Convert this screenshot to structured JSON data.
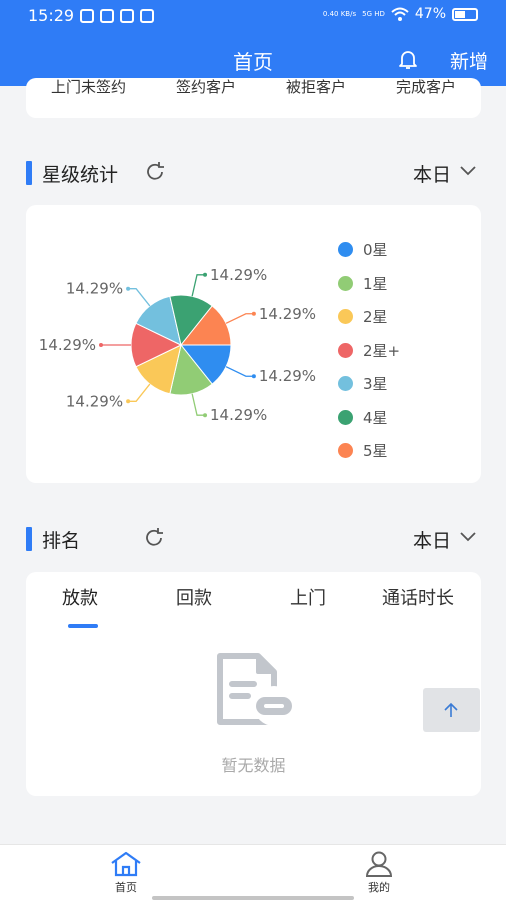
{
  "status_bar": {
    "time": "15:29",
    "network": "5G HD",
    "net_speed": "0.40 KB/s",
    "battery": "47%"
  },
  "header": {
    "title": "首页",
    "add_label": "新增",
    "bell_icon": "bell-icon"
  },
  "top_stats": {
    "labels": [
      "上门未签约",
      "签约客户",
      "被拒客户",
      "完成客户"
    ]
  },
  "star_section": {
    "title": "星级统计",
    "period": "本日"
  },
  "chart_data": {
    "type": "pie",
    "title": "",
    "labels": [
      "0星",
      "1星",
      "2星",
      "2星+",
      "3星",
      "4星",
      "5星"
    ],
    "values": [
      14.29,
      14.29,
      14.29,
      14.29,
      14.29,
      14.29,
      14.29
    ],
    "value_labels": [
      "14.29%",
      "14.29%",
      "14.29%",
      "14.29%",
      "14.29%",
      "14.29%",
      "14.29%"
    ],
    "colors": [
      "#2f8df0",
      "#91cc75",
      "#fac858",
      "#ee6666",
      "#73c0de",
      "#3ba272",
      "#fc8452"
    ],
    "legend_position": "right"
  },
  "rank_section": {
    "title": "排名",
    "period": "本日",
    "tabs": [
      "放款",
      "回款",
      "上门",
      "通话时长"
    ],
    "active_tab": "放款",
    "empty_text": "暂无数据"
  },
  "tabbar": {
    "items": [
      {
        "label": "首页",
        "icon": "home-icon",
        "active": true
      },
      {
        "label": "我的",
        "icon": "user-icon",
        "active": false
      }
    ]
  },
  "colors": {
    "primary": "#2f7cf6",
    "background": "#f3f4f6"
  }
}
